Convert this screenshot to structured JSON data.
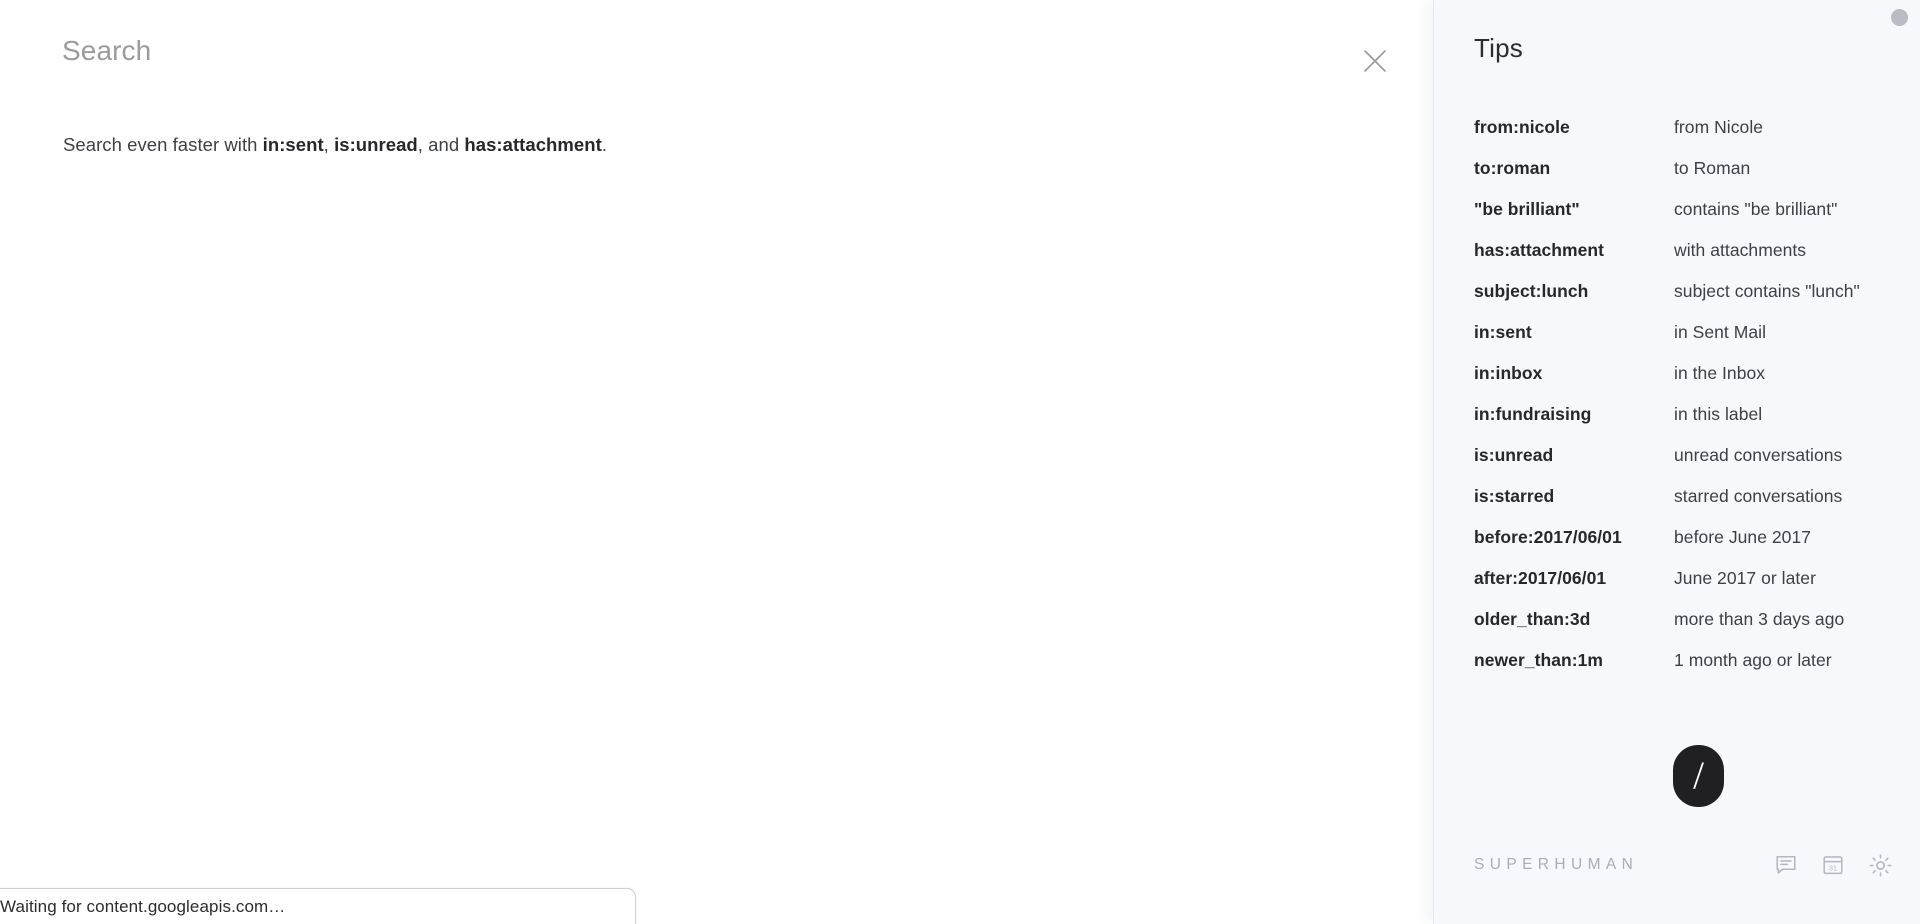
{
  "search": {
    "placeholder": "Search",
    "value": "",
    "close_icon": "close-icon",
    "hint": {
      "prefix": "Search even faster with ",
      "op1": "in:sent",
      "sep1": ", ",
      "op2": "is:unread",
      "sep2": ", and ",
      "op3": "has:attachment",
      "suffix": "."
    }
  },
  "status_bar": {
    "text": "Waiting for content.googleapis.com…"
  },
  "tips": {
    "title": "Tips",
    "rows": [
      {
        "key": "from:nicole",
        "desc": "from Nicole"
      },
      {
        "key": "to:roman",
        "desc": "to Roman"
      },
      {
        "key": "\"be brilliant\"",
        "desc": "contains \"be brilliant\""
      },
      {
        "key": "has:attachment",
        "desc": "with attachments"
      },
      {
        "key": "subject:lunch",
        "desc": "subject contains \"lunch\""
      },
      {
        "key": "in:sent",
        "desc": "in Sent Mail"
      },
      {
        "key": "in:inbox",
        "desc": "in the Inbox"
      },
      {
        "key": "in:fundraising",
        "desc": "in this label"
      },
      {
        "key": "is:unread",
        "desc": "unread conversations"
      },
      {
        "key": "is:starred",
        "desc": "starred conversations"
      },
      {
        "key": "before:2017/06/01",
        "desc": "before June 2017"
      },
      {
        "key": "after:2017/06/01",
        "desc": "June 2017 or later"
      },
      {
        "key": "older_than:3d",
        "desc": "more than 3 days ago"
      },
      {
        "key": "newer_than:1m",
        "desc": "1 month ago or later"
      }
    ]
  },
  "shortcut_badge": {
    "key": "/",
    "background": "#201f22",
    "foreground": "#ffffff"
  },
  "footer": {
    "wordmark": "SUPERHUMAN",
    "icons": [
      {
        "name": "chat-icon",
        "label": "Chat"
      },
      {
        "name": "calendar-icon",
        "label": "Calendar",
        "day": "31"
      },
      {
        "name": "gear-icon",
        "label": "Settings"
      }
    ]
  },
  "colors": {
    "page_background": "#ffffff",
    "panel_background": "#f7f8fc",
    "text_primary": "#26282c",
    "text_secondary": "#3d4045",
    "placeholder": "#9b9b9d",
    "wordmark": "#a9adb8",
    "dot": "#b9bcc4"
  }
}
